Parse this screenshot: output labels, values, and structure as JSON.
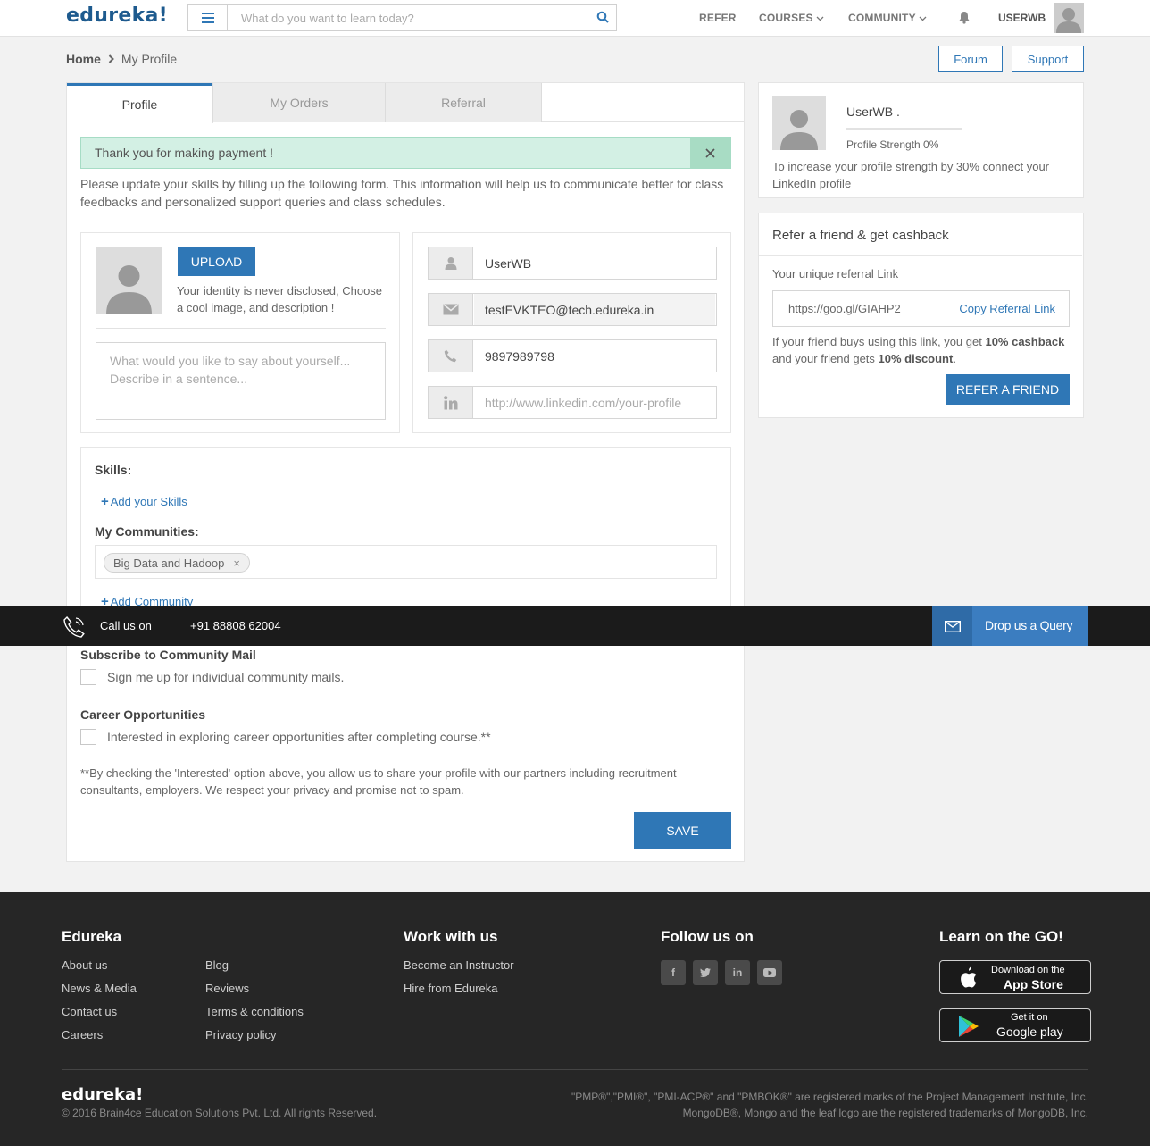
{
  "header": {
    "logo": "edureka!",
    "search_placeholder": "What do you want to learn today?",
    "nav": {
      "refer": "REFER",
      "courses": "COURSES",
      "community": "COMMUNITY"
    },
    "user_name": "USERWB"
  },
  "breadcrumb": {
    "home": "Home",
    "current": "My Profile"
  },
  "top_buttons": {
    "forum": "Forum",
    "support": "Support"
  },
  "tabs": [
    {
      "label": "Profile",
      "active": true
    },
    {
      "label": "My Orders",
      "active": false
    },
    {
      "label": "Referral",
      "active": false
    }
  ],
  "alert": {
    "message": "Thank you for making payment !"
  },
  "intro_text": "Please update your skills by filling up the following form. This information will help us to communicate better for class feedbacks and personalized support queries and class schedules.",
  "profile_form": {
    "upload_label": "UPLOAD",
    "identity_note": "Your identity is never disclosed, Choose a cool image, and description !",
    "about_placeholder": "What would you like to say about yourself... Describe in a sentence...",
    "name_value": "UserWB",
    "email_value": "testEVKTEO@tech.edureka.in",
    "phone_value": "9897989798",
    "linkedin_placeholder": "http://www.linkedin.com/your-profile"
  },
  "skills": {
    "skills_label": "Skills:",
    "add_skills": "Add your Skills",
    "communities_label": "My Communities:",
    "communities": [
      {
        "name": "Big Data and Hadoop"
      }
    ],
    "add_community": "Add Community"
  },
  "subscriptions": {
    "community_mail_heading": "Subscribe to Community Mail",
    "community_mail_label": "Sign me up for individual community mails.",
    "career_heading": "Career Opportunities",
    "career_label": "Interested in exploring career opportunities after completing course.**",
    "disclaimer": "**By checking the 'Interested' option above, you allow us to share your profile with our partners including recruitment consultants, employers. We respect your privacy and promise not to spam.",
    "save_label": "SAVE"
  },
  "profile_card": {
    "name": "UserWB .",
    "strength_label": "Profile Strength 0%",
    "strength_value": 0,
    "note": "To increase your profile strength by 30% connect your LinkedIn profile"
  },
  "referral_card": {
    "title": "Refer a friend & get cashback",
    "link_label": "Your unique referral Link",
    "link_url": "https://goo.gl/GIAHP2",
    "copy_label": "Copy Referral Link",
    "desc_pre": "If your friend buys using this link, you get ",
    "desc_cashback": "10% cashback",
    "desc_mid": " and your friend gets ",
    "desc_discount": "10% discount",
    "desc_end": ".",
    "button_label": "REFER A FRIEND"
  },
  "callbar": {
    "label": "Call us on",
    "number": "+91 88808 62004",
    "query_label": "Drop us a Query"
  },
  "footer": {
    "col1_heading": "Edureka",
    "col1_links_a": [
      "About us",
      "News & Media",
      "Contact us",
      "Careers"
    ],
    "col1_links_b": [
      "Blog",
      "Reviews",
      "Terms & conditions",
      "Privacy policy"
    ],
    "col2_heading": "Work with us",
    "col2_links": [
      "Become an Instructor",
      "Hire from Edureka"
    ],
    "col3_heading": "Follow us on",
    "social_icons": [
      "facebook-icon",
      "twitter-icon",
      "linkedin-icon",
      "youtube-icon"
    ],
    "col4_heading": "Learn on the GO!",
    "appstore_small": "Download on the",
    "appstore_big": "App Store",
    "googleplay_small": "Get it on",
    "googleplay_big": "Google play",
    "logo": "edureka!",
    "copyright": "© 2016 Brain4ce Education Solutions Pvt. Ltd. All rights Reserved.",
    "trademark_1": "\"PMP®\",\"PMI®\", \"PMI-ACP®\" and \"PMBOK®\" are registered marks of the Project Management Institute, Inc.",
    "trademark_2": "MongoDB®, Mongo and the leaf logo are the registered trademarks of MongoDB, Inc."
  },
  "colors": {
    "accent": "#2f77b6",
    "alert_bg": "#d3f0e4",
    "footer_bg": "#262626",
    "callbar_bg": "#1b1b1b"
  }
}
